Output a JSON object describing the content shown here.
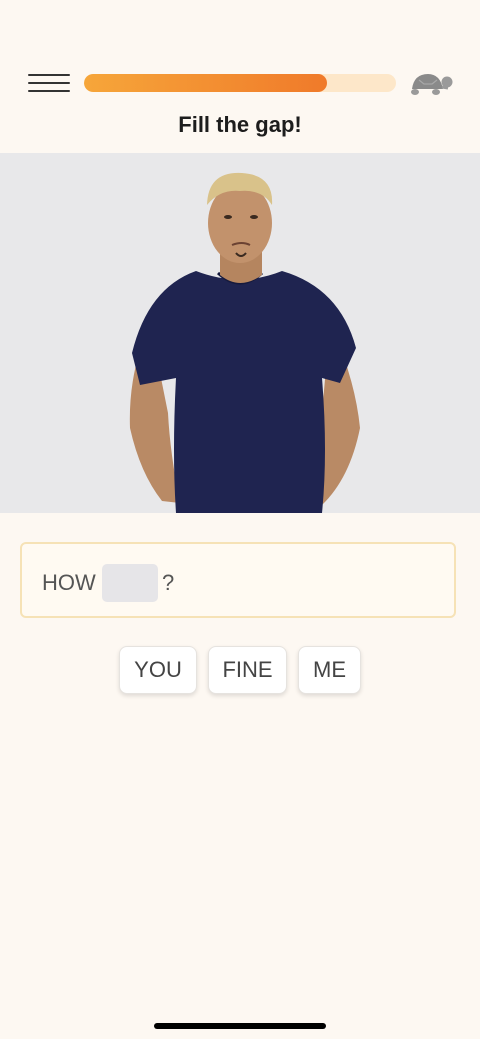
{
  "header": {
    "title": "Fill the gap!",
    "progress_fraction": 0.78,
    "accent_color": "#f07a2a",
    "track_color": "#fde7c9"
  },
  "icons": {
    "menu": "hamburger-menu-icon",
    "speed": "turtle-icon"
  },
  "sentence": {
    "words": [
      "HOW",
      "?"
    ],
    "gap_color": "#e6e5e8"
  },
  "choices": [
    "YOU",
    "FINE",
    "ME"
  ]
}
